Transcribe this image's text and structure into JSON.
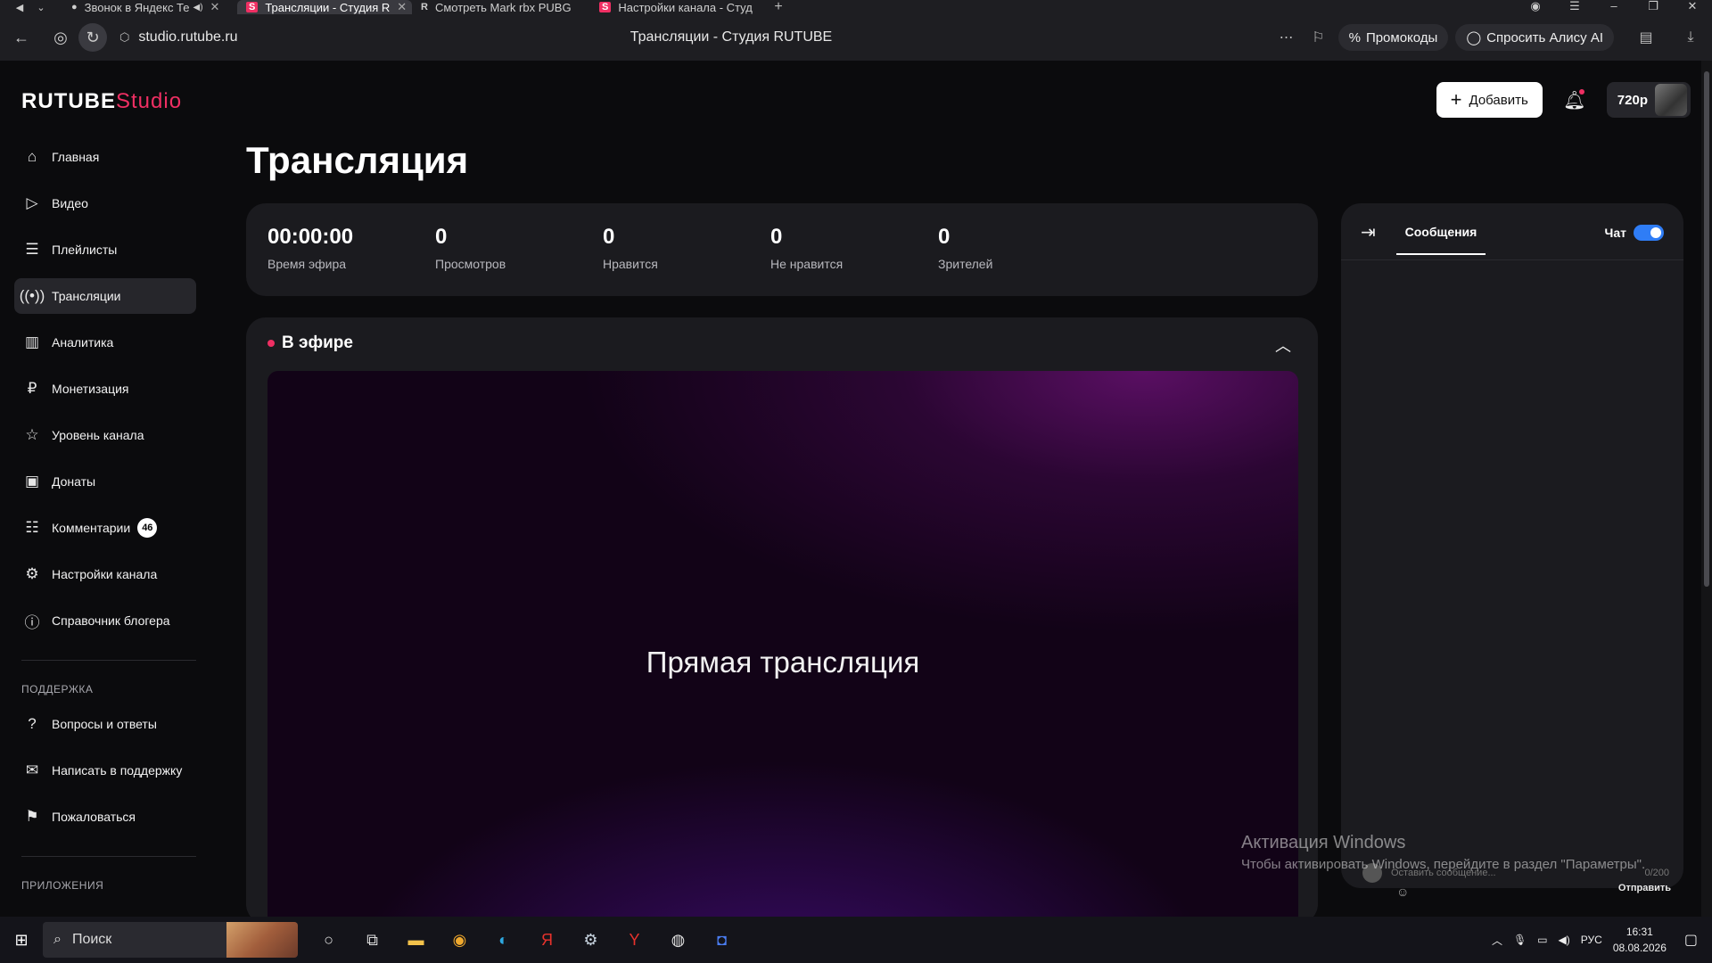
{
  "browser": {
    "tabs": [
      {
        "favicon": "●",
        "title": "Звонок в Яндекс Те",
        "has_audio": true
      },
      {
        "favicon": "S",
        "title": "Трансляции - Студия R",
        "active": true
      },
      {
        "favicon": "R",
        "title": "Смотреть Mark rbx PUBG"
      },
      {
        "favicon": "S",
        "title": "Настройки канала - Студ"
      }
    ],
    "url": "studio.rutube.ru",
    "page_title": "Трансляции - Студия RUTUBE",
    "promo_label": "Промокоды",
    "alice_label": "Спросить Алису AI"
  },
  "app": {
    "logo": {
      "main": "RUTUBE",
      "suffix": "Studio"
    },
    "header": {
      "add_label": "Добавить",
      "quality": "720p"
    },
    "nav": [
      {
        "label": "Главная",
        "icon": "home-icon"
      },
      {
        "label": "Видео",
        "icon": "video-icon"
      },
      {
        "label": "Плейлисты",
        "icon": "playlist-icon"
      },
      {
        "label": "Трансляции",
        "icon": "broadcast-icon",
        "active": true
      },
      {
        "label": "Аналитика",
        "icon": "analytics-icon"
      },
      {
        "label": "Монетизация",
        "icon": "ruble-icon"
      },
      {
        "label": "Уровень канала",
        "icon": "star-icon"
      },
      {
        "label": "Донаты",
        "icon": "donate-icon"
      },
      {
        "label": "Комментарии",
        "icon": "comment-icon",
        "badge": "46"
      },
      {
        "label": "Настройки канала",
        "icon": "gear-icon"
      },
      {
        "label": "Справочник блогера",
        "icon": "info-icon"
      }
    ],
    "support_label": "ПОДДЕРЖКА",
    "support_nav": [
      {
        "label": "Вопросы и ответы",
        "icon": "question-icon"
      },
      {
        "label": "Написать в поддержку",
        "icon": "mail-icon"
      },
      {
        "label": "Пожаловаться",
        "icon": "flag-icon"
      }
    ],
    "apps_label": "ПРИЛОЖЕНИЯ",
    "page_heading": "Трансляция",
    "stats": [
      {
        "value": "00:00:00",
        "label": "Время эфира"
      },
      {
        "value": "0",
        "label": "Просмотров"
      },
      {
        "value": "0",
        "label": "Нравится"
      },
      {
        "value": "0",
        "label": "Не нравится"
      },
      {
        "value": "0",
        "label": "Зрителей"
      }
    ],
    "live": {
      "title": "В эфире",
      "player_text": "Прямая трансляция"
    },
    "chat": {
      "tab_label": "Сообщения",
      "toggle_label": "Чат",
      "toggle_on": true,
      "input_placeholder": "Оставить сообщение...",
      "counter": "0/200",
      "send_label": "Отправить"
    }
  },
  "watermark": {
    "line1": "Активация Windows",
    "line2": "Чтобы активировать Windows, перейдите в раздел \"Параметры\"."
  },
  "taskbar": {
    "search_label": "Поиск",
    "lang": "РУС",
    "time": "16:31",
    "date": "08.08.2026"
  },
  "colors": {
    "accent": "#ef2f63",
    "toggle": "#2f7df6"
  }
}
